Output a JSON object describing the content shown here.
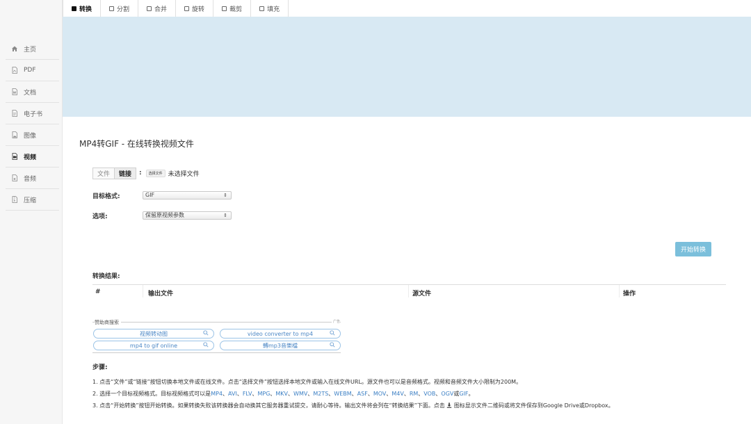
{
  "sidebar": {
    "items": [
      {
        "label": "主页",
        "icon": "home-icon"
      },
      {
        "label": "PDF",
        "icon": "pdf-file-icon"
      },
      {
        "label": "文档",
        "icon": "word-file-icon"
      },
      {
        "label": "电子书",
        "icon": "ebook-file-icon"
      },
      {
        "label": "图像",
        "icon": "image-file-icon"
      },
      {
        "label": "视频",
        "icon": "video-file-icon",
        "active": true
      },
      {
        "label": "音频",
        "icon": "audio-file-icon"
      },
      {
        "label": "压缩",
        "icon": "archive-file-icon"
      }
    ]
  },
  "tabs": [
    {
      "label": "转换",
      "active": true
    },
    {
      "label": "分割"
    },
    {
      "label": "合并"
    },
    {
      "label": "旋转"
    },
    {
      "label": "裁剪"
    },
    {
      "label": "填充"
    }
  ],
  "page": {
    "title": "MP4转GIF - 在线转换视频文件"
  },
  "source": {
    "file_label": "文件",
    "link_label": "链接",
    "colon": ":",
    "choose_button": "选择文件",
    "no_file_text": "未选择文件"
  },
  "form": {
    "target_label": "目标格式:",
    "target_value": "GIF",
    "options_label": "选项:",
    "options_value": "保留原视频参数",
    "arrow": "⇕"
  },
  "actions": {
    "start_label": "开始转换"
  },
  "results": {
    "label": "转换结果:",
    "columns": [
      "#",
      "输出文件",
      "源文件",
      "操作"
    ]
  },
  "sponsor": {
    "title": "赞助商搜索",
    "ad_mark": "广告",
    "pills": [
      "视频转动图",
      "video converter to mp4",
      "mp4 to gif online",
      "轉mp3音樂檔"
    ]
  },
  "steps": {
    "title": "步骤:",
    "step1": "1. 点击“文件”或“链接”按钮切换本地文件或在线文件。点击“选择文件”按钮选择本地文件或输入在线文件URL。源文件也可以是音频格式。视频和音频文件大小限制为200M。",
    "step2_prefix": "2. 选择一个目标视频格式。目标视频格式可以是",
    "step2_formats": [
      "MP4",
      "AVI",
      "FLV",
      "MPG",
      "MKV",
      "WMV",
      "M2TS",
      "WEBM",
      "ASF",
      "MOV",
      "M4V",
      "RM",
      "VOB",
      "OGV"
    ],
    "step2_sep": "、",
    "step2_or": "或",
    "step2_last": "GIF",
    "step2_end": "。",
    "step3_prefix": "3. 点击“开始转换”按钮开始转换。如果转换失败该转换器会自动换其它服务器重试提交，请耐心等待。输出文件将会列在“转换结果”下面。点击",
    "step3_suffix": "图标显示文件二维码或将文件保存到Google Drive或Dropbox。"
  },
  "colors": {
    "banner": "#d8e9f3",
    "accent_button": "#7bbfdb",
    "link": "#3b7fc4",
    "pill_border": "#9bc3e6"
  }
}
